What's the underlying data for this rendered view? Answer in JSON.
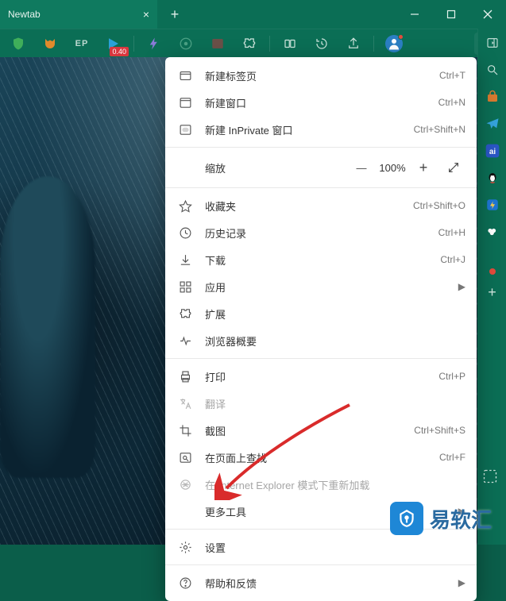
{
  "tab": {
    "title": "Newtab",
    "close": "×"
  },
  "newtab_plus": "+",
  "window_controls": {
    "min": "—",
    "max": "☐",
    "close": "×"
  },
  "toolbar": {
    "shield": "shield",
    "fox": "fox",
    "ep": "EP",
    "play_badge": "0.40",
    "bolt": "bolt",
    "refresh": "ai",
    "pic": "pic",
    "puzzle": "puzzle",
    "tabs": "tabs",
    "history": "history",
    "share": "share",
    "more": "⋯"
  },
  "sidebar": {
    "collapse": "collapse",
    "items": [
      "search",
      "bag",
      "send",
      "baidu",
      "qq",
      "thunder",
      "cloud"
    ],
    "plus": "+"
  },
  "menu": {
    "new_tab": {
      "label": "新建标签页",
      "shortcut": "Ctrl+T"
    },
    "new_window": {
      "label": "新建窗口",
      "shortcut": "Ctrl+N"
    },
    "new_inprivate": {
      "label": "新建 InPrivate 窗口",
      "shortcut": "Ctrl+Shift+N"
    },
    "zoom": {
      "label": "缩放",
      "minus": "—",
      "value": "100%",
      "plus": "+"
    },
    "favorites": {
      "label": "收藏夹",
      "shortcut": "Ctrl+Shift+O"
    },
    "history": {
      "label": "历史记录",
      "shortcut": "Ctrl+H"
    },
    "downloads": {
      "label": "下载",
      "shortcut": "Ctrl+J"
    },
    "apps": {
      "label": "应用"
    },
    "extensions": {
      "label": "扩展"
    },
    "performance": {
      "label": "浏览器概要"
    },
    "print": {
      "label": "打印",
      "shortcut": "Ctrl+P"
    },
    "translate": {
      "label": "翻译"
    },
    "screenshot": {
      "label": "截图",
      "shortcut": "Ctrl+Shift+S"
    },
    "find": {
      "label": "在页面上查找",
      "shortcut": "Ctrl+F"
    },
    "ie_mode": {
      "label": "在 Internet Explorer 模式下重新加载"
    },
    "more_tools": {
      "label": "更多工具"
    },
    "settings": {
      "label": "设置"
    },
    "help": {
      "label": "帮助和反馈"
    }
  },
  "watermark": {
    "text": "易软汇"
  }
}
